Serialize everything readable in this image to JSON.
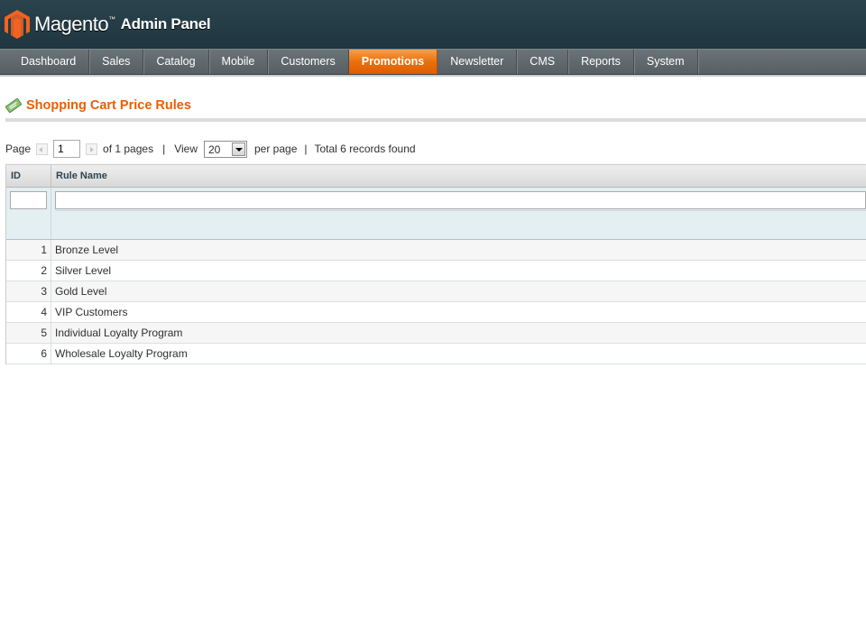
{
  "header": {
    "logo_text": "Magento",
    "logo_tm": "™",
    "logo_sub": "Admin Panel"
  },
  "nav": {
    "items": [
      {
        "label": "Dashboard"
      },
      {
        "label": "Sales"
      },
      {
        "label": "Catalog"
      },
      {
        "label": "Mobile"
      },
      {
        "label": "Customers"
      },
      {
        "label": "Promotions"
      },
      {
        "label": "Newsletter"
      },
      {
        "label": "CMS"
      },
      {
        "label": "Reports"
      },
      {
        "label": "System"
      }
    ],
    "active": "Promotions"
  },
  "page": {
    "title": "Shopping Cart Price Rules",
    "icon": "price-tag-icon"
  },
  "pager": {
    "page_label": "Page",
    "page_value": "1",
    "of_pages": "of 1 pages",
    "sep": "|",
    "view_label": "View",
    "view_value": "20",
    "per_page": "per page",
    "total": "Total 6 records found"
  },
  "grid": {
    "columns": [
      "ID",
      "Rule Name"
    ],
    "filter_id_value": "",
    "filter_name_value": "",
    "rows": [
      {
        "id": "1",
        "name": "Bronze Level"
      },
      {
        "id": "2",
        "name": "Silver Level"
      },
      {
        "id": "3",
        "name": "Gold Level"
      },
      {
        "id": "4",
        "name": "VIP Customers"
      },
      {
        "id": "5",
        "name": "Individual Loyalty Program"
      },
      {
        "id": "6",
        "name": "Wholesale Loyalty Program"
      }
    ]
  },
  "colors": {
    "header_bg": "#243c46",
    "nav_bg": "#616a6f",
    "nav_active": "#eb6a0d",
    "title": "#eb5e00",
    "filter_bg": "#e3eff1"
  }
}
